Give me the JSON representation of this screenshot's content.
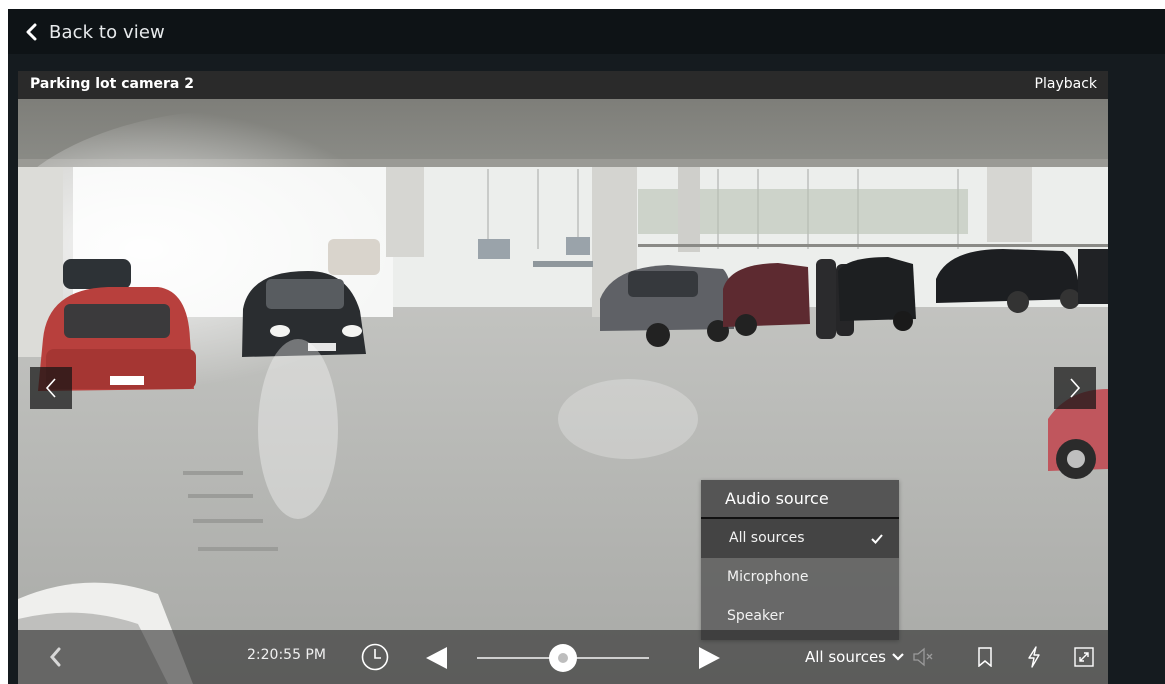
{
  "header": {
    "back_label": "Back to view"
  },
  "camera": {
    "title": "Parking lot camera 2",
    "mode": "Playback"
  },
  "audio_menu": {
    "title": "Audio source",
    "items": [
      {
        "label": "All sources",
        "selected": true
      },
      {
        "label": "Microphone",
        "selected": false
      },
      {
        "label": "Speaker",
        "selected": false
      }
    ]
  },
  "controls": {
    "time": "2:20:55 PM",
    "audio_source_value": "All sources",
    "timeline_position_pct": 50
  },
  "icons": {
    "back": "chevron-left-icon",
    "prev_camera": "chevron-left-icon",
    "next_camera": "chevron-right-icon",
    "clock": "clock-icon",
    "step_back": "triangle-left-icon",
    "step_forward": "triangle-right-icon",
    "mute": "speaker-muted-icon",
    "bookmark": "bookmark-icon",
    "event": "lightning-icon",
    "fullscreen": "expand-icon"
  },
  "colors": {
    "background": "#151b1f",
    "topbar": "#0e1316",
    "menu": "#646464"
  }
}
